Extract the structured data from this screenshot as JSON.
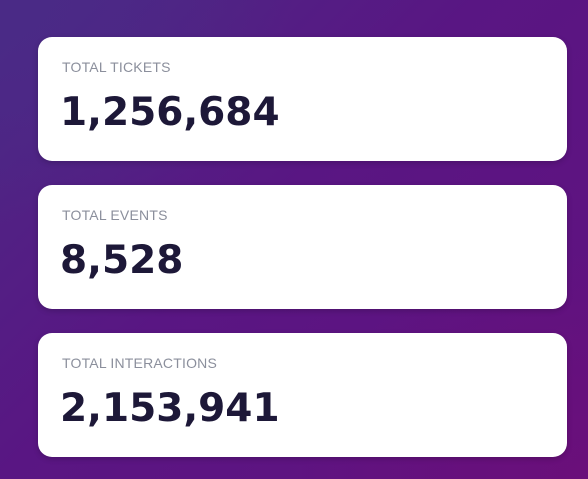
{
  "stats": [
    {
      "label": "TOTAL TICKETS",
      "value": "1,256,684"
    },
    {
      "label": "TOTAL EVENTS",
      "value": "8,528"
    },
    {
      "label": "TOTAL INTERACTIONS",
      "value": "2,153,941"
    }
  ],
  "colors": {
    "background_start": "#4b2a85",
    "background_end": "#62117f",
    "card": "#ffffff",
    "label": "#8b8f9c",
    "value": "#1d1838"
  }
}
